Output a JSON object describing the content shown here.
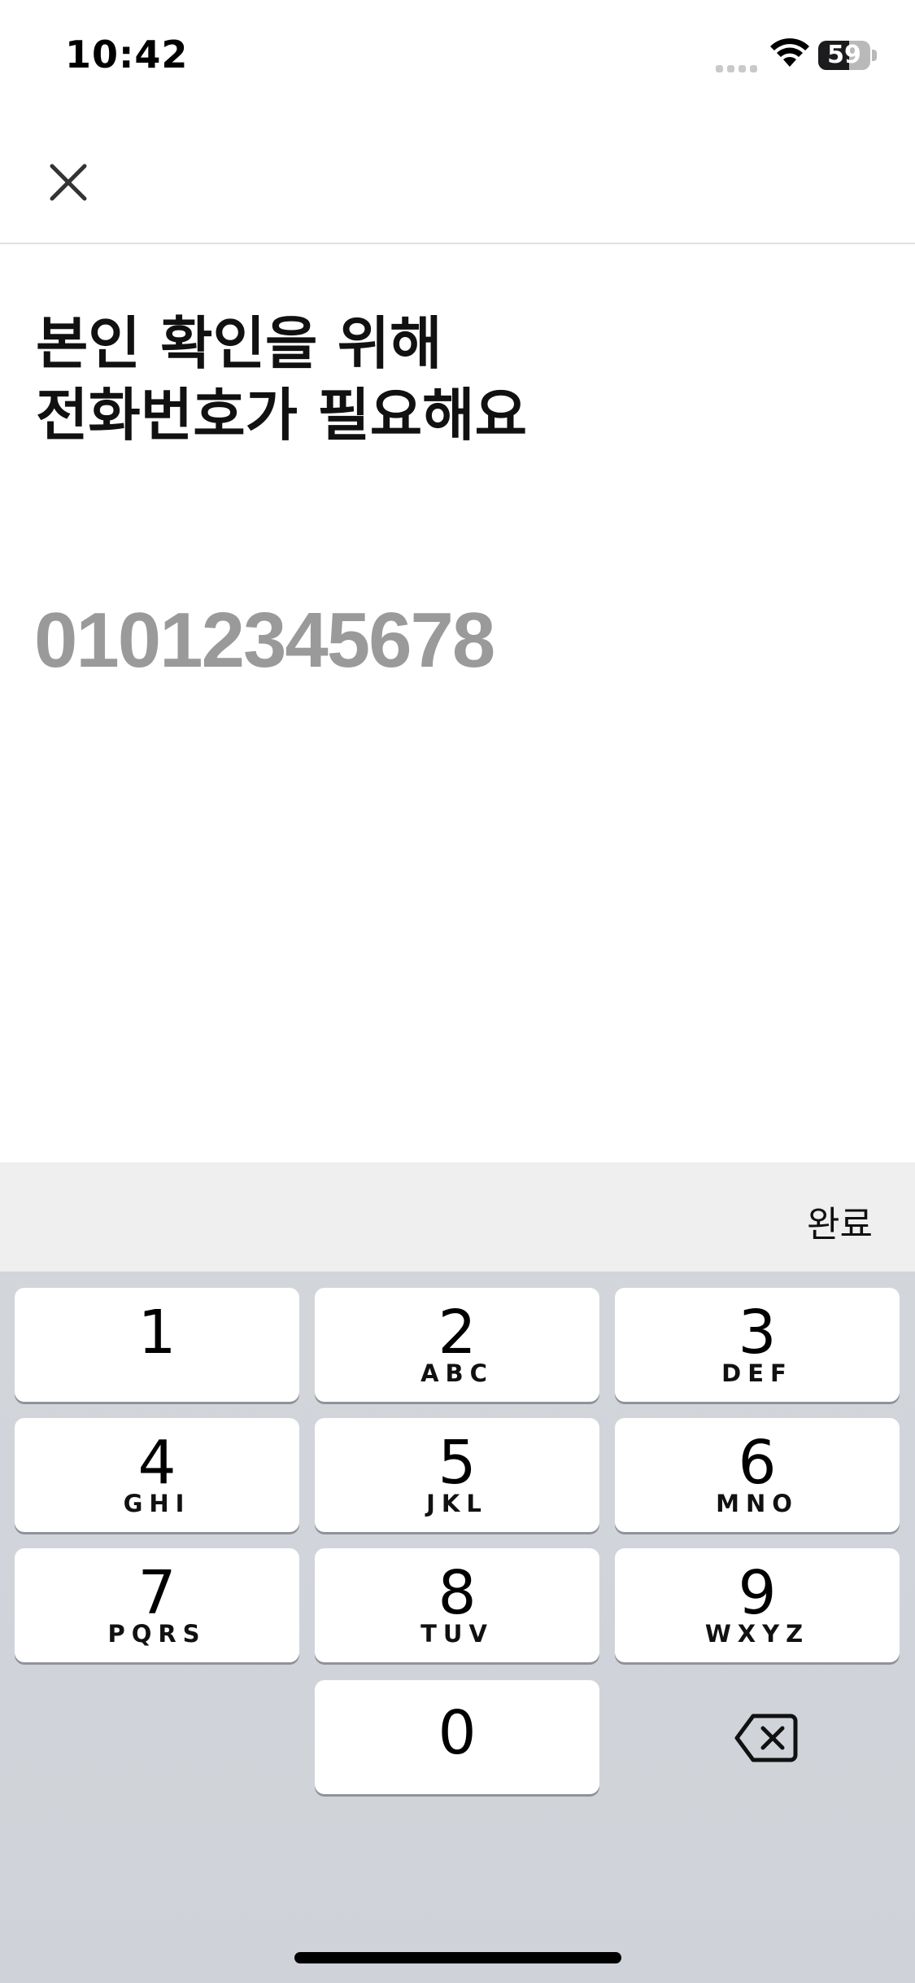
{
  "status_bar": {
    "time": "10:42",
    "battery": "59",
    "battery_level": 0.59
  },
  "nav": {
    "close_icon": "close-icon"
  },
  "heading": {
    "line1": "본인 확인을 위해",
    "line2": "전화번호가 필요해요"
  },
  "phone_field": {
    "value": "",
    "placeholder": "01012345678"
  },
  "accessory": {
    "done_label": "완료"
  },
  "keypad": {
    "keys": [
      {
        "digit": "1",
        "letters": ""
      },
      {
        "digit": "2",
        "letters": "ABC"
      },
      {
        "digit": "3",
        "letters": "DEF"
      },
      {
        "digit": "4",
        "letters": "GHI"
      },
      {
        "digit": "5",
        "letters": "JKL"
      },
      {
        "digit": "6",
        "letters": "MNO"
      },
      {
        "digit": "7",
        "letters": "PQRS"
      },
      {
        "digit": "8",
        "letters": "TUV"
      },
      {
        "digit": "9",
        "letters": "WXYZ"
      },
      {
        "digit": "0",
        "letters": ""
      }
    ],
    "backspace_icon": "backspace-icon"
  }
}
